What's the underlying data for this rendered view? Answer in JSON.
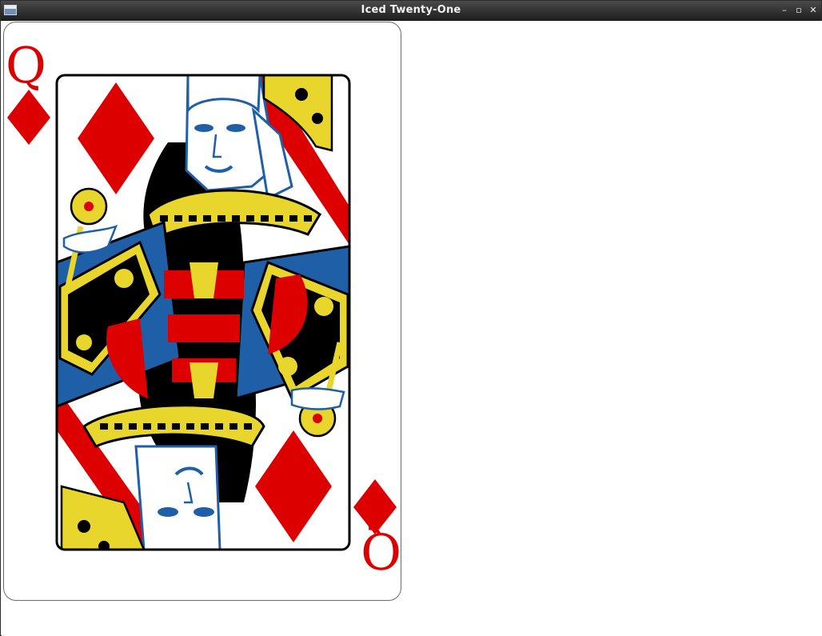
{
  "window": {
    "title": "Iced Twenty-One",
    "minimize_label": "–",
    "maximize_label": "▫",
    "close_label": "✕"
  },
  "card": {
    "rank": "Q",
    "suit": "diamonds",
    "suit_color": "#dd0000"
  },
  "colors": {
    "red": "#dd0000",
    "blue": "#1e5fa8",
    "yellow": "#e8d62c",
    "black": "#000000"
  }
}
